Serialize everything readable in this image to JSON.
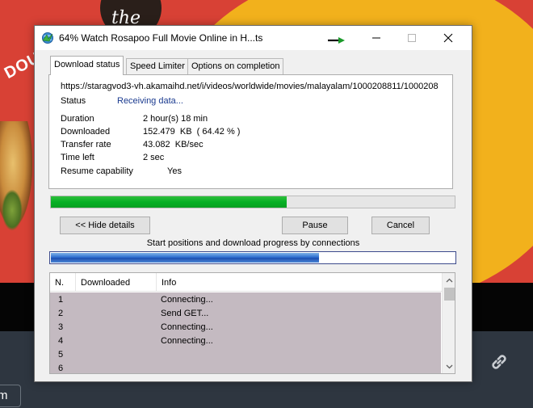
{
  "window": {
    "title": "64% Watch Rosapoo Full Movie Online in H...ts"
  },
  "tabs": [
    {
      "label": "Download status",
      "active": true
    },
    {
      "label": "Speed Limiter",
      "active": false
    },
    {
      "label": "Options on completion",
      "active": false
    }
  ],
  "status": {
    "url": "https://staragvod3-vh.akamaihd.net/i/videos/worldwide/movies/malayalam/1000208811/1000208",
    "status_label": "Status",
    "status_value": "Receiving data...",
    "duration_label": "Duration",
    "duration_value": "2 hour(s) 18 min",
    "downloaded_label": "Downloaded",
    "downloaded_value": "152.479  KB  ( 64.42 % )",
    "transfer_label": "Transfer rate",
    "transfer_value": "43.082  KB/sec",
    "timeleft_label": "Time left",
    "timeleft_value": "2 sec",
    "resume_label": "Resume capability",
    "resume_value": "Yes"
  },
  "progress": {
    "overall_fraction": 0.5842,
    "connections_fraction": 0.6637
  },
  "buttons": {
    "hide_details": "<< Hide details",
    "pause": "Pause",
    "cancel": "Cancel"
  },
  "connections": {
    "caption": "Start positions and download progress by connections",
    "columns": [
      "N.",
      "Downloaded",
      "Info"
    ],
    "rows": [
      {
        "n": "1",
        "downloaded": "",
        "info": "Connecting..."
      },
      {
        "n": "2",
        "downloaded": "",
        "info": "Send GET..."
      },
      {
        "n": "3",
        "downloaded": "",
        "info": "Connecting..."
      },
      {
        "n": "4",
        "downloaded": "",
        "info": "Connecting..."
      },
      {
        "n": "5",
        "downloaded": "",
        "info": ""
      },
      {
        "n": "6",
        "downloaded": "",
        "info": ""
      }
    ]
  },
  "background": {
    "logo_text": "the",
    "side_text": "DOUBLE",
    "pill_text": "m"
  },
  "colors": {
    "progress_green": "#06b025",
    "progress_blue": "#2f6fd0",
    "list_selected": "#c4bac1",
    "status_link": "#1a3a8f"
  },
  "icons": [
    "app-globe-icon",
    "arrow-cursor-icon",
    "minimize-icon",
    "maximize-icon",
    "close-icon",
    "scroll-up-icon",
    "scroll-down-icon",
    "link-icon"
  ]
}
